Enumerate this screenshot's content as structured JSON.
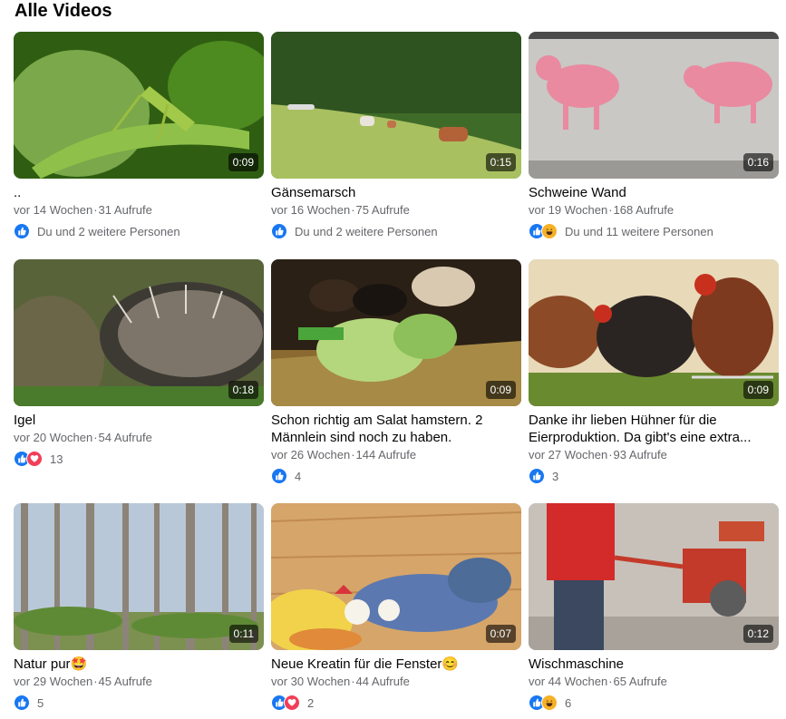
{
  "section_title": "Alle Videos",
  "videos": [
    {
      "title": "..",
      "duration": "0:09",
      "age": "vor 14 Wochen",
      "views": "31 Aufrufe",
      "reactions": [
        "like"
      ],
      "reaction_text": "Du und 2 weitere Personen",
      "thumb": "grasshopper"
    },
    {
      "title": "Gänsemarsch",
      "duration": "0:15",
      "age": "vor 16 Wochen",
      "views": "75 Aufrufe",
      "reactions": [
        "like"
      ],
      "reaction_text": "Du und 2 weitere Personen",
      "thumb": "cows"
    },
    {
      "title": "Schweine Wand",
      "duration": "0:16",
      "age": "vor 19 Wochen",
      "views": "168 Aufrufe",
      "reactions": [
        "like",
        "haha"
      ],
      "reaction_text": "Du und 11 weitere Personen",
      "thumb": "pigs"
    },
    {
      "title": "Igel",
      "duration": "0:18",
      "age": "vor 20 Wochen",
      "views": "54 Aufrufe",
      "reactions": [
        "like",
        "love"
      ],
      "reaction_text": "13",
      "thumb": "hedgehog"
    },
    {
      "title": "Schon richtig am Salat hamstern. 2 Männlein sind noch zu haben.",
      "duration": "0:09",
      "age": "vor 26 Wochen",
      "views": "144 Aufrufe",
      "reactions": [
        "like"
      ],
      "reaction_text": "4",
      "thumb": "guinea"
    },
    {
      "title": "Danke ihr lieben Hühner für die Eierproduktion. Da gibt's eine extra...",
      "duration": "0:09",
      "age": "vor 27 Wochen",
      "views": "93 Aufrufe",
      "reactions": [
        "like"
      ],
      "reaction_text": "3",
      "thumb": "hens"
    },
    {
      "title": "Natur pur🤩",
      "duration": "0:11",
      "age": "vor 29 Wochen",
      "views": "45 Aufrufe",
      "reactions": [
        "like"
      ],
      "reaction_text": "5",
      "thumb": "forest"
    },
    {
      "title": "Neue Kreatin für die Fenster😊",
      "duration": "0:07",
      "age": "vor 30 Wochen",
      "views": "44 Aufrufe",
      "reactions": [
        "like",
        "love"
      ],
      "reaction_text": "2",
      "thumb": "painting"
    },
    {
      "title": "Wischmaschine",
      "duration": "0:12",
      "age": "vor 44 Wochen",
      "views": "65 Aufrufe",
      "reactions": [
        "like",
        "haha"
      ],
      "reaction_text": "6",
      "thumb": "machine"
    }
  ],
  "colors": {
    "like": "#1877f2",
    "love": "#f33e58",
    "haha": "#f7b125",
    "meta": "#65676b"
  }
}
